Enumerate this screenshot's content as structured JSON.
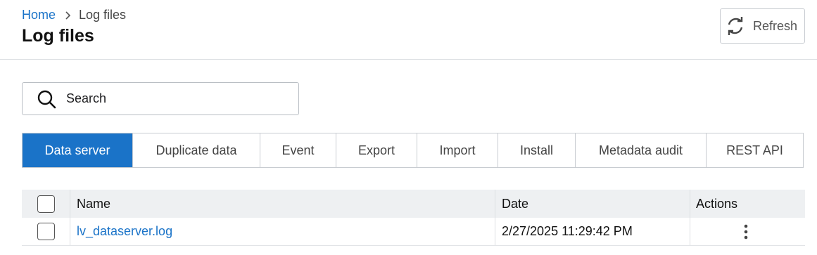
{
  "breadcrumb": {
    "home": "Home",
    "current": "Log files"
  },
  "page": {
    "title": "Log files"
  },
  "toolbar": {
    "refresh_label": "Refresh"
  },
  "search": {
    "placeholder": "Search",
    "value": ""
  },
  "tabs": [
    {
      "label": "Data server",
      "active": true
    },
    {
      "label": "Duplicate data",
      "active": false
    },
    {
      "label": "Event",
      "active": false
    },
    {
      "label": "Export",
      "active": false
    },
    {
      "label": "Import",
      "active": false
    },
    {
      "label": "Install",
      "active": false
    },
    {
      "label": "Metadata audit",
      "active": false
    },
    {
      "label": "REST API",
      "active": false
    }
  ],
  "table": {
    "headers": {
      "name": "Name",
      "date": "Date",
      "actions": "Actions"
    },
    "rows": [
      {
        "name": "lv_dataserver.log",
        "date": "2/27/2025 11:29:42 PM",
        "checked": false
      }
    ]
  },
  "icons": {
    "refresh": "refresh-icon",
    "search": "search-icon",
    "breadcrumb_separator": "chevron-right-icon",
    "row_actions": "more-vertical-icon"
  },
  "colors": {
    "accent": "#1a73c8",
    "header_row_bg": "#eef0f2",
    "border": "#c8ccd1"
  }
}
